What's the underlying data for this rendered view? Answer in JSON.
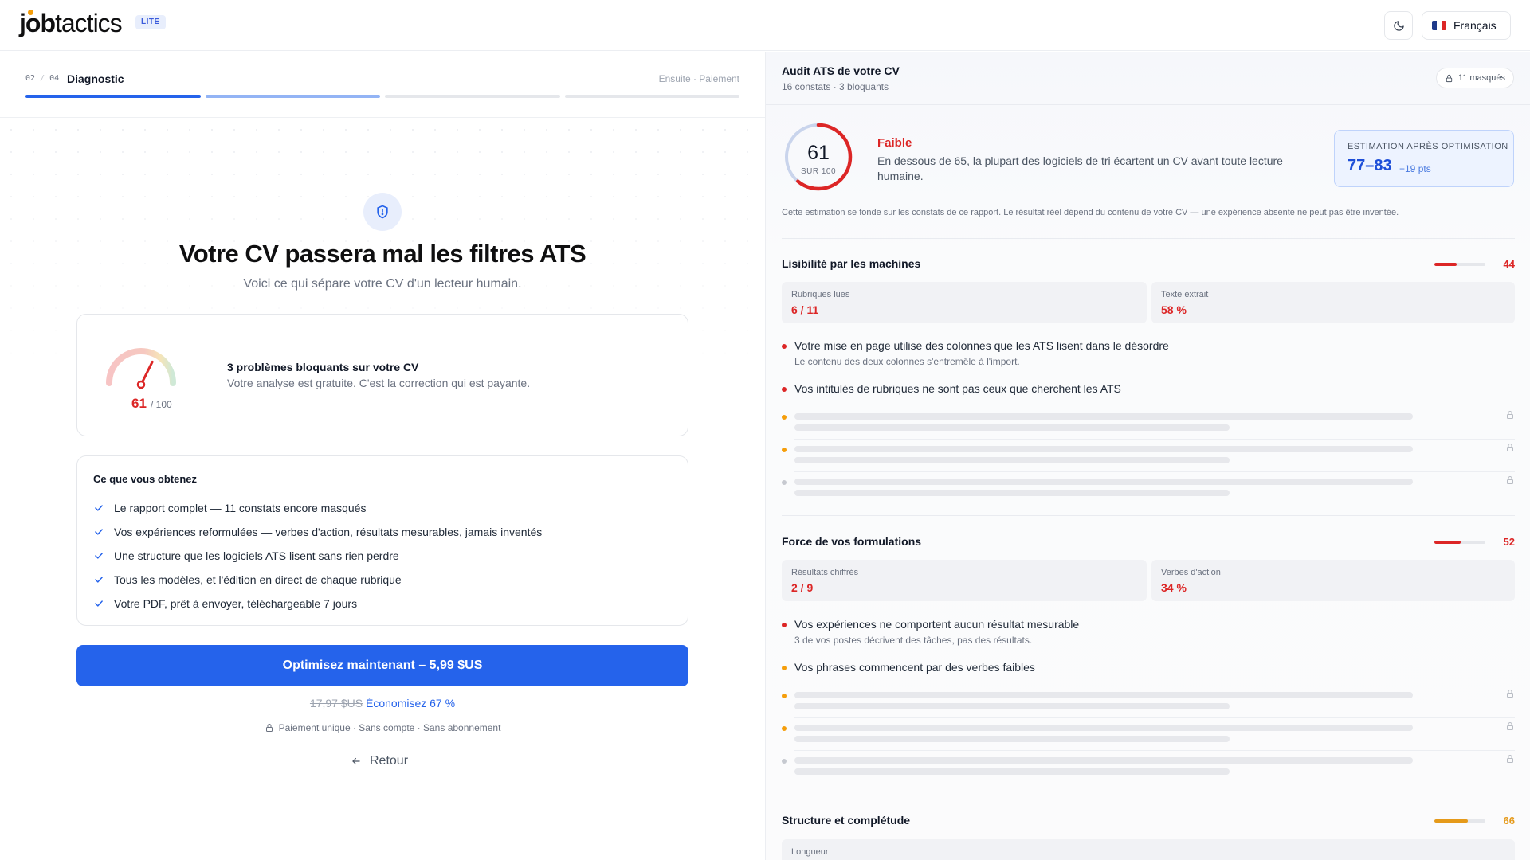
{
  "header": {
    "logo_bold": "job",
    "logo_light": "tactics",
    "badge": "LITE",
    "theme_icon": "moon-icon",
    "language": "Français"
  },
  "left": {
    "step": {
      "current": "02",
      "separator": "/",
      "total": "04",
      "name": "Diagnostic",
      "next": "Ensuite · Paiement"
    },
    "progress_fraction": 0.5,
    "hero_icon": "shield-alert-icon",
    "title": "Votre CV passera mal les filtres ATS",
    "subtitle": "Voici ce qui sépare votre CV d'un lecteur humain.",
    "score_card": {
      "score": "61",
      "score_max": "/ 100",
      "score_value": 61,
      "issue_title": "3 problèmes bloquants sur votre CV",
      "issue_sub": "Votre analyse est gratuite. C'est la correction qui est payante."
    },
    "benefits": {
      "title": "Ce que vous obtenez",
      "items": [
        "Le rapport complet — 11 constats encore masqués",
        "Vos expériences reformulées — verbes d'action, résultats mesurables, jamais inventés",
        "Une structure que les logiciels ATS lisent sans rien perdre",
        "Tous les modèles, et l'édition en direct de chaque rubrique",
        "Votre PDF, prêt à envoyer, téléchargeable 7 jours"
      ]
    },
    "cta": "Optimisez maintenant – 5,99 $US",
    "old_price": "17,97 $US",
    "savings": "Économisez 67 %",
    "payment_note": "Paiement unique · Sans compte · Sans abonnement",
    "back": "Retour"
  },
  "right": {
    "title": "Audit ATS de votre CV",
    "subtitle": "16 constats · 3 bloquants",
    "masked_pill": "11 masqués",
    "score": "61",
    "score_max": "SUR 100",
    "score_value": 61,
    "grade": "Faible",
    "grade_desc": "En dessous de 65, la plupart des logiciels de tri écartent un CV avant toute lecture humaine.",
    "estimate_label": "ESTIMATION APRÈS OPTIMISATION",
    "estimate_value": "77–83",
    "estimate_delta": "+19 pts",
    "note": "Cette estimation se fonde sur les constats de ce rapport. Le résultat réel dépend du contenu de votre CV — une expérience absente ne peut pas être inventée.",
    "sections": [
      {
        "title": "Lisibilité par les machines",
        "score": "44",
        "score_value": 44,
        "color": "#dc2626",
        "stats": [
          {
            "label": "Rubriques lues",
            "value": "6 / 11"
          },
          {
            "label": "Texte extrait",
            "value": "58 %"
          }
        ],
        "findings": [
          {
            "severity": "red",
            "title": "Votre mise en page utilise des colonnes que les ATS lisent dans le désordre",
            "sub": "Le contenu des deux colonnes s'entremêle à l'import."
          },
          {
            "severity": "red",
            "title": "Vos intitulés de rubriques ne sont pas ceux que cherchent les ATS",
            "sub": ""
          }
        ],
        "masked": [
          "orange",
          "orange",
          "gray"
        ]
      },
      {
        "title": "Force de vos formulations",
        "score": "52",
        "score_value": 52,
        "color": "#dc2626",
        "stats": [
          {
            "label": "Résultats chiffrés",
            "value": "2 / 9"
          },
          {
            "label": "Verbes d'action",
            "value": "34 %"
          }
        ],
        "findings": [
          {
            "severity": "red",
            "title": "Vos expériences ne comportent aucun résultat mesurable",
            "sub": "3 de vos postes décrivent des tâches, pas des résultats."
          },
          {
            "severity": "orange",
            "title": "Vos phrases commencent par des verbes faibles",
            "sub": ""
          }
        ],
        "masked": [
          "orange",
          "orange",
          "gray"
        ]
      },
      {
        "title": "Structure et complétude",
        "score": "66",
        "score_value": 66,
        "color": "#e59a1a",
        "stats": [
          {
            "label": "Longueur",
            "value": ""
          }
        ]
      }
    ]
  },
  "colors": {
    "accent": "#2563eb",
    "danger": "#dc2626",
    "warning": "#f59e0b",
    "muted": "#c6c9d0"
  }
}
